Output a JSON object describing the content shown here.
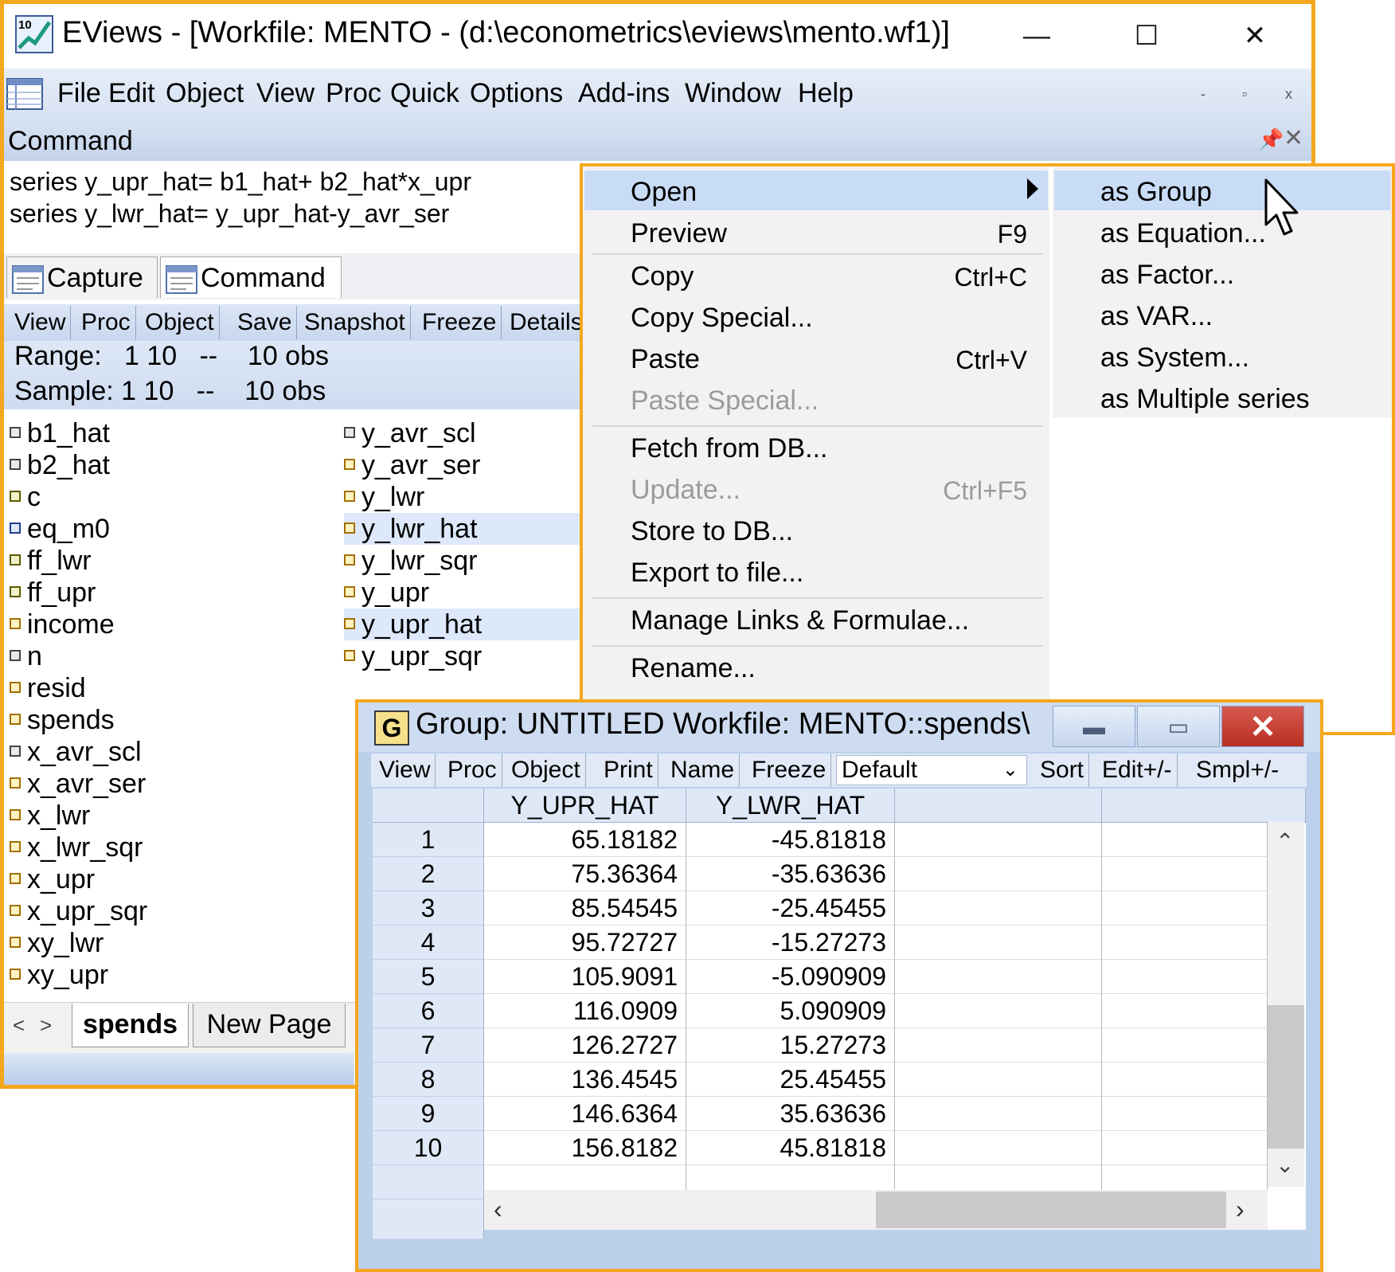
{
  "window": {
    "title": "EViews - [Workfile: MENTO - (d:\\econometrics\\eviews\\mento.wf1)]",
    "app_icon_badge": "10",
    "controls": [
      "—",
      "☐",
      "✕"
    ]
  },
  "menubar": {
    "items": [
      "File",
      "Edit",
      "Object",
      "View",
      "Proc",
      "Quick",
      "Options",
      "Add-ins",
      "Window",
      "Help"
    ],
    "mdi_controls": [
      "-",
      "▫",
      "x"
    ]
  },
  "command": {
    "title": "Command",
    "lines": [
      "series y_upr_hat= b1_hat+ b2_hat*x_upr",
      "series y_lwr_hat= y_upr_hat-y_avr_ser"
    ],
    "tabs": [
      "Capture",
      "Command"
    ]
  },
  "workfile": {
    "toolbar": [
      "View",
      "Proc",
      "Object",
      "Save",
      "Snapshot",
      "Freeze",
      "Details"
    ],
    "range": "Range:   1 10   --    10 obs",
    "sample": "Sample: 1 10   --    10 obs",
    "objects_left": [
      {
        "name": "b1_hat",
        "icon": "scalar-icon"
      },
      {
        "name": "b2_hat",
        "icon": "scalar-icon"
      },
      {
        "name": "c",
        "icon": "coef-icon"
      },
      {
        "name": "eq_m0",
        "icon": "equation-icon"
      },
      {
        "name": "ff_lwr",
        "icon": "coef-icon"
      },
      {
        "name": "ff_upr",
        "icon": "coef-icon"
      },
      {
        "name": "income",
        "icon": "series-icon"
      },
      {
        "name": "n",
        "icon": "scalar-icon"
      },
      {
        "name": "resid",
        "icon": "series-icon"
      },
      {
        "name": "spends",
        "icon": "series-icon"
      },
      {
        "name": "x_avr_scl",
        "icon": "scalar-icon"
      },
      {
        "name": "x_avr_ser",
        "icon": "series-icon"
      },
      {
        "name": "x_lwr",
        "icon": "series-icon"
      },
      {
        "name": "x_lwr_sqr",
        "icon": "series-icon"
      },
      {
        "name": "x_upr",
        "icon": "series-icon"
      },
      {
        "name": "x_upr_sqr",
        "icon": "series-icon"
      },
      {
        "name": "xy_lwr",
        "icon": "series-icon"
      },
      {
        "name": "xy_upr",
        "icon": "series-icon"
      }
    ],
    "objects_right": [
      {
        "name": "y_avr_scl",
        "icon": "scalar-icon",
        "selected": false
      },
      {
        "name": "y_avr_ser",
        "icon": "series-icon",
        "selected": false
      },
      {
        "name": "y_lwr",
        "icon": "series-icon",
        "selected": false
      },
      {
        "name": "y_lwr_hat",
        "icon": "series-icon",
        "selected": true
      },
      {
        "name": "y_lwr_sqr",
        "icon": "series-icon",
        "selected": false
      },
      {
        "name": "y_upr",
        "icon": "series-icon",
        "selected": false
      },
      {
        "name": "y_upr_hat",
        "icon": "series-icon",
        "selected": true
      },
      {
        "name": "y_upr_sqr",
        "icon": "series-icon",
        "selected": false
      }
    ],
    "page_nav": [
      "<",
      ">"
    ],
    "page_tabs": [
      "spends",
      "New Page"
    ]
  },
  "context_menu": {
    "items": [
      {
        "label": "Open",
        "shortcut": "",
        "disabled": false,
        "submenu": true,
        "highlighted": true
      },
      {
        "label": "Preview",
        "shortcut": "F9",
        "disabled": false
      },
      {
        "label": "Copy",
        "shortcut": "Ctrl+C",
        "disabled": false
      },
      {
        "label": "Copy Special...",
        "shortcut": "",
        "disabled": false
      },
      {
        "label": "Paste",
        "shortcut": "Ctrl+V",
        "disabled": false
      },
      {
        "label": "Paste Special...",
        "shortcut": "",
        "disabled": true
      },
      {
        "label": "Fetch from DB...",
        "shortcut": "",
        "disabled": false
      },
      {
        "label": "Update...",
        "shortcut": "Ctrl+F5",
        "disabled": true
      },
      {
        "label": "Store to DB...",
        "shortcut": "",
        "disabled": false
      },
      {
        "label": "Export to file...",
        "shortcut": "",
        "disabled": false
      },
      {
        "label": "Manage Links & Formulae...",
        "shortcut": "",
        "disabled": false
      },
      {
        "label": "Rename...",
        "shortcut": "",
        "disabled": false
      }
    ],
    "submenu": [
      "as Group",
      "as Equation...",
      "as Factor...",
      "as VAR...",
      "as System...",
      "as Multiple series"
    ]
  },
  "group_window": {
    "icon_letter": "G",
    "title": "Group: UNTITLED   Workfile: MENTO::spends\\",
    "toolbar": [
      "View",
      "Proc",
      "Object",
      "Print",
      "Name",
      "Freeze"
    ],
    "combo_value": "Default",
    "toolbar_right": [
      "Sort",
      "Edit+/-",
      "Smpl+/-"
    ],
    "columns": [
      "Y_UPR_HAT",
      "Y_LWR_HAT"
    ],
    "rows": [
      {
        "obs": "1",
        "y_upr_hat": "65.18182",
        "y_lwr_hat": "-45.81818"
      },
      {
        "obs": "2",
        "y_upr_hat": "75.36364",
        "y_lwr_hat": "-35.63636"
      },
      {
        "obs": "3",
        "y_upr_hat": "85.54545",
        "y_lwr_hat": "-25.45455"
      },
      {
        "obs": "4",
        "y_upr_hat": "95.72727",
        "y_lwr_hat": "-15.27273"
      },
      {
        "obs": "5",
        "y_upr_hat": "105.9091",
        "y_lwr_hat": "-5.090909"
      },
      {
        "obs": "6",
        "y_upr_hat": "116.0909",
        "y_lwr_hat": "5.090909"
      },
      {
        "obs": "7",
        "y_upr_hat": "126.2727",
        "y_lwr_hat": "15.27273"
      },
      {
        "obs": "8",
        "y_upr_hat": "136.4545",
        "y_lwr_hat": "25.45455"
      },
      {
        "obs": "9",
        "y_upr_hat": "146.6364",
        "y_lwr_hat": "35.63636"
      },
      {
        "obs": "10",
        "y_upr_hat": "156.8182",
        "y_lwr_hat": "45.81818"
      }
    ]
  },
  "colors": {
    "highlight_border": "#f4a71d",
    "menu_highlight": "#c9dcf6",
    "selected_object": "#dde8fb"
  }
}
